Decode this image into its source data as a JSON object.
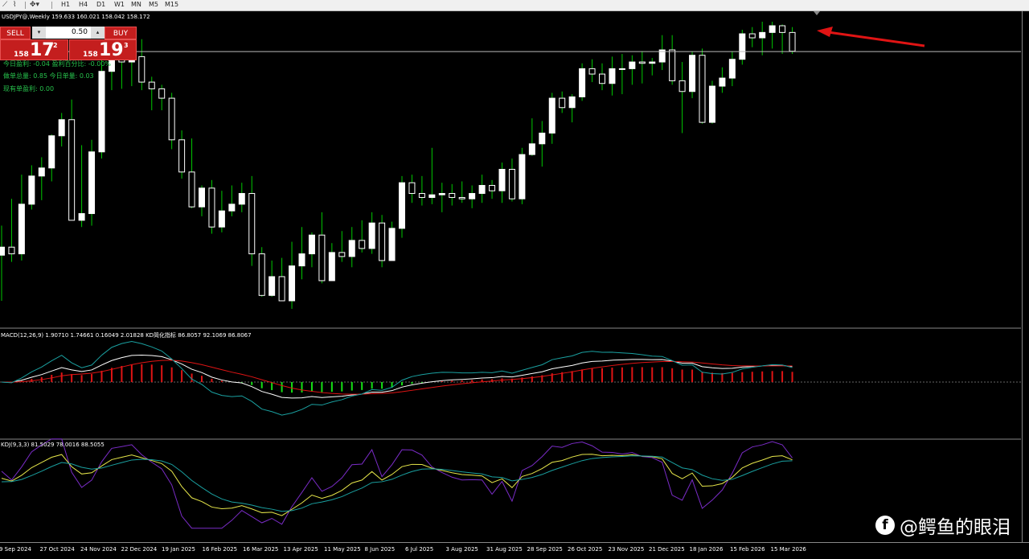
{
  "toolbar": {
    "timeframes": [
      "H1",
      "H4",
      "D1",
      "W1",
      "MN",
      "M5",
      "M15"
    ]
  },
  "chart": {
    "title": "USDJPY@,Weekly  159.633 160.021 158.042 158.172",
    "macd_label": "MACD(12,26,9) 1.90710 1.74661 0.16049 2.01828  KD简化指标 86.8057 92.1069 86.8067",
    "kdj_label": "KDJ(9,3,3) 81.5029 78.0016 88.5055"
  },
  "one_click": {
    "sell_label": "SELL",
    "buy_label": "BUY",
    "lot": "0.50",
    "sell_price_small": "158",
    "sell_price_big": "17",
    "sell_price_sup": "2",
    "buy_price_small": "158",
    "buy_price_big": "19",
    "buy_price_sup": "3"
  },
  "stats": {
    "line1": "今日盈利: -0.04   盈利百分比: -0.00%",
    "line2": "做单总量: 0.85    今日单量: 0.03",
    "line3": "现有单盈利: 0.00"
  },
  "date_axis": [
    "9 Sep 2024",
    "27 Oct 2024",
    "24 Nov 2024",
    "22 Dec 2024",
    "19 Jan 2025",
    "16 Feb 2025",
    "16 Mar 2025",
    "13 Apr 2025",
    "11 May 2025",
    "8 Jun 2025",
    "6 Jul 2025",
    "3 Aug 2025",
    "31 Aug 2025",
    "28 Sep 2025",
    "26 Oct 2025",
    "23 Nov 2025",
    "21 Dec 2025",
    "18 Jan 2026",
    "15 Feb 2026",
    "15 Mar 2026"
  ],
  "watermark": "@鳄鱼的眼泪",
  "colors": {
    "bull": "#ffffff",
    "bear": "#000000",
    "wick": "#00c800",
    "macd_up": "#e01414",
    "macd_down": "#14e014",
    "annotation_arrow": "#e01414"
  },
  "chart_data": {
    "type": "candlestick",
    "timeframe": "Weekly",
    "symbol": "USDJPY",
    "candles": [
      {
        "o": 143.0,
        "h": 145.2,
        "l": 139.6,
        "c": 143.6
      },
      {
        "o": 143.6,
        "h": 147.2,
        "l": 142.5,
        "c": 143.1
      },
      {
        "o": 143.1,
        "h": 149.0,
        "l": 142.6,
        "c": 146.8
      },
      {
        "o": 146.8,
        "h": 149.7,
        "l": 146.4,
        "c": 148.9
      },
      {
        "o": 148.9,
        "h": 150.3,
        "l": 147.1,
        "c": 149.5
      },
      {
        "o": 149.5,
        "h": 152.0,
        "l": 148.5,
        "c": 151.9
      },
      {
        "o": 151.9,
        "h": 153.6,
        "l": 151.1,
        "c": 153.1
      },
      {
        "o": 153.1,
        "h": 154.6,
        "l": 145.8,
        "c": 145.6
      },
      {
        "o": 145.6,
        "h": 151.2,
        "l": 145.1,
        "c": 146.1
      },
      {
        "o": 146.1,
        "h": 151.6,
        "l": 145.2,
        "c": 150.7
      },
      {
        "o": 150.7,
        "h": 157.9,
        "l": 150.2,
        "c": 156.7
      },
      {
        "o": 156.7,
        "h": 158.0,
        "l": 155.3,
        "c": 157.9
      },
      {
        "o": 157.9,
        "h": 158.5,
        "l": 155.4,
        "c": 157.4
      },
      {
        "o": 157.4,
        "h": 158.3,
        "l": 155.6,
        "c": 157.8
      },
      {
        "o": 157.8,
        "h": 159.1,
        "l": 155.3,
        "c": 155.9
      },
      {
        "o": 155.9,
        "h": 156.3,
        "l": 153.8,
        "c": 155.4
      },
      {
        "o": 155.4,
        "h": 155.7,
        "l": 153.8,
        "c": 154.7
      },
      {
        "o": 154.7,
        "h": 155.1,
        "l": 150.9,
        "c": 151.6
      },
      {
        "o": 151.6,
        "h": 152.3,
        "l": 148.7,
        "c": 149.2
      },
      {
        "o": 149.2,
        "h": 151.7,
        "l": 146.5,
        "c": 146.6
      },
      {
        "o": 146.6,
        "h": 148.2,
        "l": 145.9,
        "c": 148.0
      },
      {
        "o": 148.0,
        "h": 148.6,
        "l": 144.6,
        "c": 145.1
      },
      {
        "o": 145.1,
        "h": 147.8,
        "l": 144.7,
        "c": 146.3
      },
      {
        "o": 146.3,
        "h": 148.2,
        "l": 145.9,
        "c": 146.8
      },
      {
        "o": 146.8,
        "h": 148.4,
        "l": 146.2,
        "c": 147.6
      },
      {
        "o": 147.6,
        "h": 148.9,
        "l": 142.2,
        "c": 143.1
      },
      {
        "o": 143.1,
        "h": 143.6,
        "l": 139.9,
        "c": 140.0
      },
      {
        "o": 140.0,
        "h": 142.6,
        "l": 139.9,
        "c": 141.4
      },
      {
        "o": 141.4,
        "h": 142.8,
        "l": 139.8,
        "c": 139.6
      },
      {
        "o": 139.6,
        "h": 144.0,
        "l": 139.0,
        "c": 142.2
      },
      {
        "o": 142.2,
        "h": 145.1,
        "l": 141.2,
        "c": 143.1
      },
      {
        "o": 143.1,
        "h": 144.7,
        "l": 142.1,
        "c": 144.5
      },
      {
        "o": 144.5,
        "h": 146.2,
        "l": 140.9,
        "c": 141.1
      },
      {
        "o": 141.1,
        "h": 143.9,
        "l": 141.2,
        "c": 143.2
      },
      {
        "o": 143.2,
        "h": 144.8,
        "l": 142.5,
        "c": 142.9
      },
      {
        "o": 142.9,
        "h": 145.1,
        "l": 142.1,
        "c": 144.1
      },
      {
        "o": 144.1,
        "h": 145.6,
        "l": 143.2,
        "c": 143.5
      },
      {
        "o": 143.5,
        "h": 146.2,
        "l": 143.1,
        "c": 145.4
      },
      {
        "o": 145.4,
        "h": 146.0,
        "l": 142.1,
        "c": 142.6
      },
      {
        "o": 142.6,
        "h": 145.5,
        "l": 142.6,
        "c": 145.0
      },
      {
        "o": 145.0,
        "h": 148.9,
        "l": 144.3,
        "c": 148.4
      },
      {
        "o": 148.4,
        "h": 149.0,
        "l": 146.9,
        "c": 147.6
      },
      {
        "o": 147.6,
        "h": 148.9,
        "l": 146.7,
        "c": 147.3
      },
      {
        "o": 147.3,
        "h": 151.0,
        "l": 146.8,
        "c": 147.5
      },
      {
        "o": 147.5,
        "h": 148.4,
        "l": 146.2,
        "c": 147.6
      },
      {
        "o": 147.6,
        "h": 148.3,
        "l": 146.7,
        "c": 147.3
      },
      {
        "o": 147.3,
        "h": 148.5,
        "l": 146.9,
        "c": 147.2
      },
      {
        "o": 147.2,
        "h": 148.2,
        "l": 146.5,
        "c": 147.6
      },
      {
        "o": 147.6,
        "h": 149.0,
        "l": 146.9,
        "c": 148.2
      },
      {
        "o": 148.2,
        "h": 148.6,
        "l": 147.2,
        "c": 147.8
      },
      {
        "o": 147.8,
        "h": 149.9,
        "l": 146.9,
        "c": 149.4
      },
      {
        "o": 149.4,
        "h": 150.2,
        "l": 147.0,
        "c": 147.2
      },
      {
        "o": 147.2,
        "h": 151.0,
        "l": 146.8,
        "c": 150.5
      },
      {
        "o": 150.5,
        "h": 153.2,
        "l": 150.4,
        "c": 151.3
      },
      {
        "o": 151.3,
        "h": 153.0,
        "l": 149.6,
        "c": 152.1
      },
      {
        "o": 152.1,
        "h": 155.1,
        "l": 151.3,
        "c": 154.7
      },
      {
        "o": 154.7,
        "h": 155.2,
        "l": 153.6,
        "c": 154.0
      },
      {
        "o": 154.0,
        "h": 155.0,
        "l": 152.9,
        "c": 154.8
      },
      {
        "o": 154.8,
        "h": 157.3,
        "l": 154.5,
        "c": 156.9
      },
      {
        "o": 156.9,
        "h": 157.6,
        "l": 155.9,
        "c": 156.5
      },
      {
        "o": 156.5,
        "h": 157.3,
        "l": 155.3,
        "c": 155.8
      },
      {
        "o": 155.8,
        "h": 157.8,
        "l": 154.9,
        "c": 156.9
      },
      {
        "o": 156.9,
        "h": 158.0,
        "l": 155.0,
        "c": 156.9
      },
      {
        "o": 156.9,
        "h": 157.9,
        "l": 155.7,
        "c": 157.4
      },
      {
        "o": 157.4,
        "h": 158.2,
        "l": 155.8,
        "c": 157.3
      },
      {
        "o": 157.3,
        "h": 157.7,
        "l": 156.4,
        "c": 157.4
      },
      {
        "o": 157.4,
        "h": 159.4,
        "l": 156.8,
        "c": 158.3
      },
      {
        "o": 158.3,
        "h": 159.4,
        "l": 155.7,
        "c": 156.0
      },
      {
        "o": 156.0,
        "h": 157.4,
        "l": 152.1,
        "c": 155.2
      },
      {
        "o": 155.2,
        "h": 158.2,
        "l": 154.7,
        "c": 157.9
      },
      {
        "o": 157.9,
        "h": 158.4,
        "l": 152.8,
        "c": 152.9
      },
      {
        "o": 152.9,
        "h": 156.0,
        "l": 152.8,
        "c": 155.6
      },
      {
        "o": 155.6,
        "h": 157.0,
        "l": 155.1,
        "c": 156.2
      },
      {
        "o": 156.2,
        "h": 158.2,
        "l": 155.6,
        "c": 157.6
      },
      {
        "o": 157.6,
        "h": 159.8,
        "l": 157.2,
        "c": 159.5
      },
      {
        "o": 159.5,
        "h": 160.0,
        "l": 158.5,
        "c": 159.2
      },
      {
        "o": 159.2,
        "h": 160.4,
        "l": 157.9,
        "c": 159.6
      },
      {
        "o": 159.6,
        "h": 160.4,
        "l": 158.4,
        "c": 160.1
      },
      {
        "o": 160.1,
        "h": 160.2,
        "l": 158.0,
        "c": 159.6
      },
      {
        "o": 159.6,
        "h": 160.0,
        "l": 158.0,
        "c": 158.2
      }
    ],
    "current_price": 158.172,
    "macd": {
      "macd_line": 1.9071,
      "signal": 1.74661,
      "histogram": 0.16049,
      "value4": 2.01828,
      "kd_values": [
        86.8057,
        92.1069,
        86.8067
      ]
    },
    "kdj": {
      "k": 81.5029,
      "d": 78.0016,
      "j": 88.5055
    }
  }
}
